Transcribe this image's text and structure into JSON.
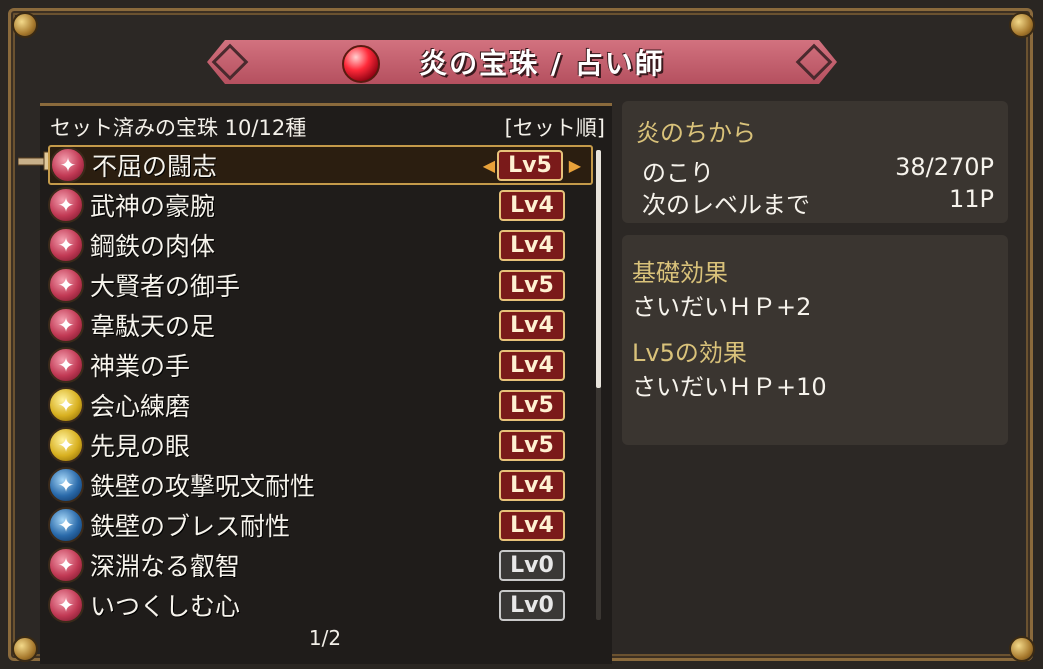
{
  "title": "炎の宝珠 / 占い師",
  "list_header": {
    "label": "セット済みの宝珠 10/12種",
    "sort": "[セット順]"
  },
  "gems": [
    {
      "name": "不屈の闘志",
      "level": "Lv5",
      "element": "fire",
      "selected": true
    },
    {
      "name": "武神の豪腕",
      "level": "Lv4",
      "element": "fire"
    },
    {
      "name": "鋼鉄の肉体",
      "level": "Lv4",
      "element": "fire"
    },
    {
      "name": "大賢者の御手",
      "level": "Lv5",
      "element": "fire"
    },
    {
      "name": "韋駄天の足",
      "level": "Lv4",
      "element": "fire"
    },
    {
      "name": "神業の手",
      "level": "Lv4",
      "element": "fire"
    },
    {
      "name": "会心練磨",
      "level": "Lv5",
      "element": "light"
    },
    {
      "name": "先見の眼",
      "level": "Lv5",
      "element": "light"
    },
    {
      "name": "鉄壁の攻撃呪文耐性",
      "level": "Lv4",
      "element": "water"
    },
    {
      "name": "鉄壁のブレス耐性",
      "level": "Lv4",
      "element": "water"
    },
    {
      "name": "深淵なる叡智",
      "level": "Lv0",
      "element": "fire"
    },
    {
      "name": "いつくしむ心",
      "level": "Lv0",
      "element": "fire"
    }
  ],
  "page": "1/2",
  "power": {
    "title": "炎のちから",
    "remaining_label": "のこり",
    "remaining_value": "38/270P",
    "next_label": "次のレベルまで",
    "next_value": "11P"
  },
  "effects": {
    "base_title": "基礎効果",
    "base_text": "さいだいＨＰ+2",
    "level_title": "Lv5の効果",
    "level_text": "さいだいＨＰ+10"
  }
}
